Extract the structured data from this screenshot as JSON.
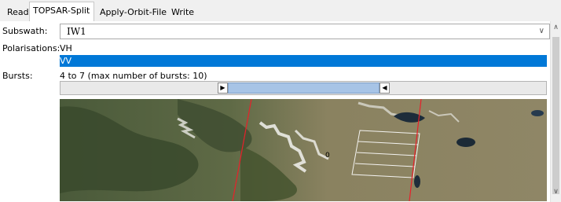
{
  "tabs": [
    {
      "label": "Read"
    },
    {
      "label": "TOPSAR-Split"
    },
    {
      "label": "Apply-Orbit-File"
    },
    {
      "label": "Write"
    }
  ],
  "subswath": {
    "label": "Subswath:",
    "value": "IW1"
  },
  "polarisations": {
    "label": "Polarisations:",
    "options": [
      "VH",
      "VV"
    ],
    "selected": "VV"
  },
  "bursts": {
    "label": "Bursts:",
    "text": "4 to 7 (max number of bursts: 10)",
    "selected_start_fraction": 0.35,
    "selected_end_fraction": 0.66
  },
  "map": {
    "burst_marker": "0",
    "footprint_color": "#e8202a"
  },
  "colors": {
    "accent": "#0078d7",
    "range_fill": "#a7c4e6"
  },
  "icons": {
    "dropdown": "chevron-down-icon",
    "scroll_up": "chevron-up-icon",
    "scroll_down": "chevron-down-icon",
    "handle_left": "triangle-right-icon",
    "handle_right": "triangle-left-icon"
  }
}
